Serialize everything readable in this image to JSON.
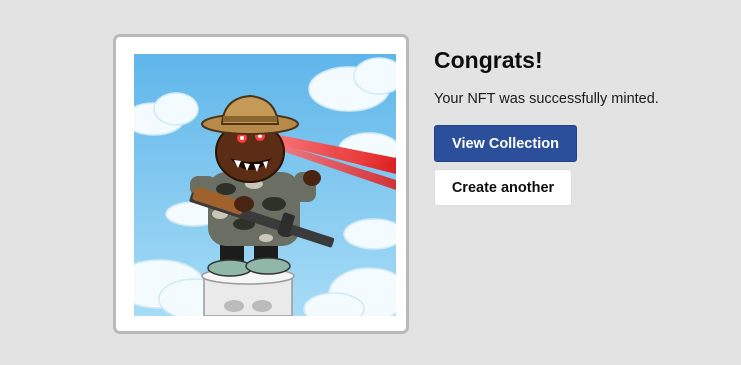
{
  "result": {
    "title": "Congrats!",
    "message": "Your NFT was successfully minted."
  },
  "actions": {
    "view_collection_label": "View Collection",
    "create_another_label": "Create another"
  },
  "nft": {
    "description": "Cartoon bear with laser eyes holding a rifle, standing on a pillar in the sky",
    "sky_color": "#7ec8ee",
    "laser_color": "#ff2a2a"
  },
  "colors": {
    "background": "#e3e3e3",
    "primary_button": "#2b4f9b",
    "frame_border": "#b9b9b9"
  }
}
